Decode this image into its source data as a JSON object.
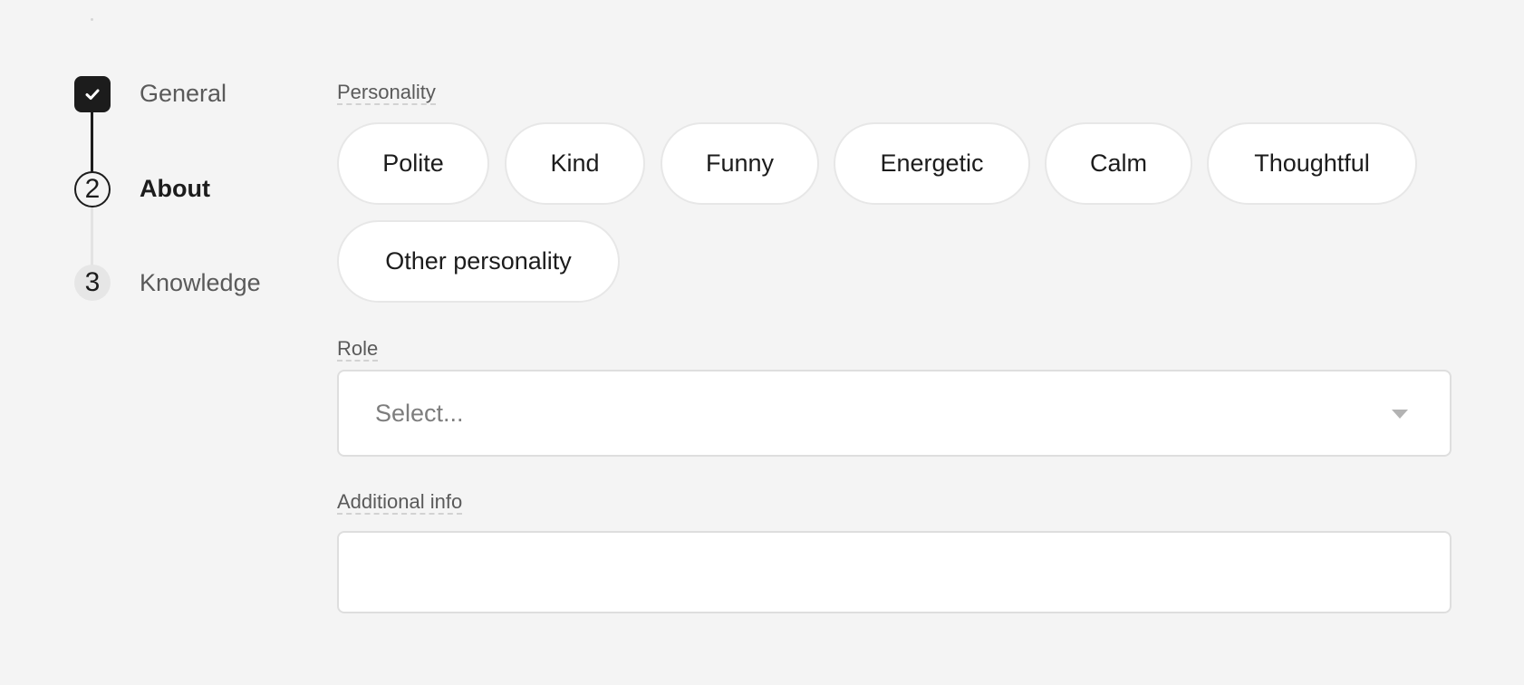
{
  "stepper": {
    "steps": [
      {
        "label": "General",
        "marker": "",
        "state": "completed",
        "icon": "check-icon"
      },
      {
        "label": "About",
        "marker": "2",
        "state": "current"
      },
      {
        "label": "Knowledge",
        "marker": "3",
        "state": "upcoming"
      }
    ]
  },
  "form": {
    "personality": {
      "label": "Personality",
      "options": [
        "Polite",
        "Kind",
        "Funny",
        "Energetic",
        "Calm",
        "Thoughtful",
        "Other personality"
      ]
    },
    "role": {
      "label": "Role",
      "placeholder": "Select...",
      "caret_icon": "caret-down-icon"
    },
    "additional_info": {
      "label": "Additional info",
      "value": ""
    }
  },
  "colors": {
    "background": "#f4f4f4",
    "text": "#1c1c1c",
    "muted_text": "#5a5a5a",
    "completed_step": "#1c1c1c",
    "upcoming_step": "#e6e6e6",
    "chip_border": "#e7e7e7"
  }
}
